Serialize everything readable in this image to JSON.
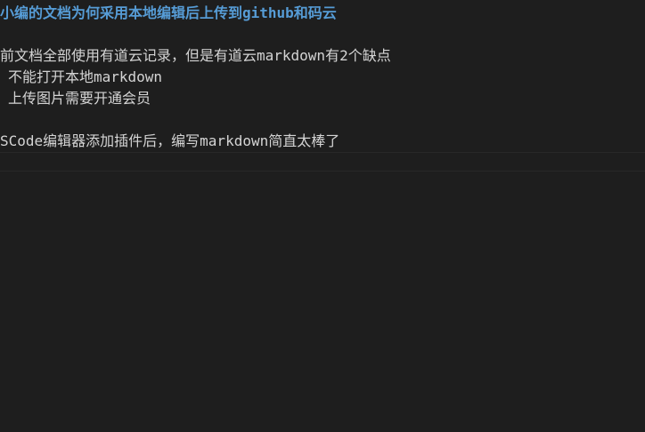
{
  "editor": {
    "lines": [
      "小编的文档为何采用本地编辑后上传到github和码云",
      "",
      "前文档全部使用有道云记录，但是有道云markdown有2个缺点",
      "不能打开本地markdown",
      "上传图片需要开通会员",
      "",
      "SCode编辑器添加插件后，编写markdown简直太棒了"
    ]
  },
  "colors": {
    "background": "#1e1e1e",
    "text": "#d4d4d4",
    "heading": "#569cd6"
  }
}
